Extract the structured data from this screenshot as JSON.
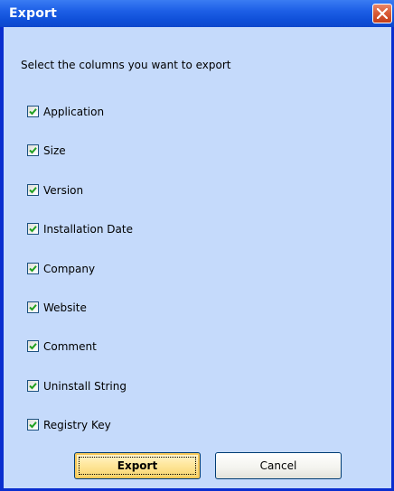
{
  "window": {
    "title": "Export",
    "close_icon": "close-icon"
  },
  "dialog": {
    "prompt": "Select the columns you want to export",
    "options": [
      {
        "label": "Application",
        "checked": true
      },
      {
        "label": "Size",
        "checked": true
      },
      {
        "label": "Version",
        "checked": true
      },
      {
        "label": "Installation Date",
        "checked": true
      },
      {
        "label": "Company",
        "checked": true
      },
      {
        "label": "Website",
        "checked": true
      },
      {
        "label": "Comment",
        "checked": true
      },
      {
        "label": "Uninstall String",
        "checked": true
      },
      {
        "label": "Registry Key",
        "checked": true
      }
    ],
    "export_label": "Export",
    "cancel_label": "Cancel"
  },
  "colors": {
    "titlebar": "#0f4fd8",
    "client_background": "#c5dafb",
    "checkmark": "#21a121",
    "default_button": "#f8d46a"
  }
}
